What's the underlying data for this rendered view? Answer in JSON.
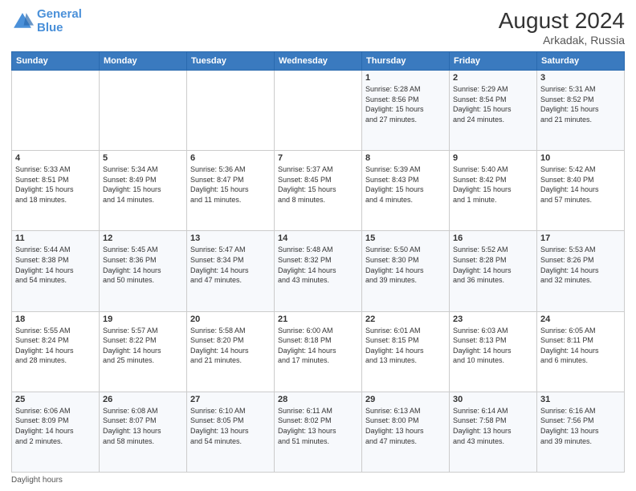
{
  "logo": {
    "line1": "General",
    "line2": "Blue"
  },
  "header": {
    "month_year": "August 2024",
    "location": "Arkadak, Russia"
  },
  "footer": {
    "note": "Daylight hours"
  },
  "days_of_week": [
    "Sunday",
    "Monday",
    "Tuesday",
    "Wednesday",
    "Thursday",
    "Friday",
    "Saturday"
  ],
  "weeks": [
    [
      {
        "day": "",
        "info": ""
      },
      {
        "day": "",
        "info": ""
      },
      {
        "day": "",
        "info": ""
      },
      {
        "day": "",
        "info": ""
      },
      {
        "day": "1",
        "info": "Sunrise: 5:28 AM\nSunset: 8:56 PM\nDaylight: 15 hours\nand 27 minutes."
      },
      {
        "day": "2",
        "info": "Sunrise: 5:29 AM\nSunset: 8:54 PM\nDaylight: 15 hours\nand 24 minutes."
      },
      {
        "day": "3",
        "info": "Sunrise: 5:31 AM\nSunset: 8:52 PM\nDaylight: 15 hours\nand 21 minutes."
      }
    ],
    [
      {
        "day": "4",
        "info": "Sunrise: 5:33 AM\nSunset: 8:51 PM\nDaylight: 15 hours\nand 18 minutes."
      },
      {
        "day": "5",
        "info": "Sunrise: 5:34 AM\nSunset: 8:49 PM\nDaylight: 15 hours\nand 14 minutes."
      },
      {
        "day": "6",
        "info": "Sunrise: 5:36 AM\nSunset: 8:47 PM\nDaylight: 15 hours\nand 11 minutes."
      },
      {
        "day": "7",
        "info": "Sunrise: 5:37 AM\nSunset: 8:45 PM\nDaylight: 15 hours\nand 8 minutes."
      },
      {
        "day": "8",
        "info": "Sunrise: 5:39 AM\nSunset: 8:43 PM\nDaylight: 15 hours\nand 4 minutes."
      },
      {
        "day": "9",
        "info": "Sunrise: 5:40 AM\nSunset: 8:42 PM\nDaylight: 15 hours\nand 1 minute."
      },
      {
        "day": "10",
        "info": "Sunrise: 5:42 AM\nSunset: 8:40 PM\nDaylight: 14 hours\nand 57 minutes."
      }
    ],
    [
      {
        "day": "11",
        "info": "Sunrise: 5:44 AM\nSunset: 8:38 PM\nDaylight: 14 hours\nand 54 minutes."
      },
      {
        "day": "12",
        "info": "Sunrise: 5:45 AM\nSunset: 8:36 PM\nDaylight: 14 hours\nand 50 minutes."
      },
      {
        "day": "13",
        "info": "Sunrise: 5:47 AM\nSunset: 8:34 PM\nDaylight: 14 hours\nand 47 minutes."
      },
      {
        "day": "14",
        "info": "Sunrise: 5:48 AM\nSunset: 8:32 PM\nDaylight: 14 hours\nand 43 minutes."
      },
      {
        "day": "15",
        "info": "Sunrise: 5:50 AM\nSunset: 8:30 PM\nDaylight: 14 hours\nand 39 minutes."
      },
      {
        "day": "16",
        "info": "Sunrise: 5:52 AM\nSunset: 8:28 PM\nDaylight: 14 hours\nand 36 minutes."
      },
      {
        "day": "17",
        "info": "Sunrise: 5:53 AM\nSunset: 8:26 PM\nDaylight: 14 hours\nand 32 minutes."
      }
    ],
    [
      {
        "day": "18",
        "info": "Sunrise: 5:55 AM\nSunset: 8:24 PM\nDaylight: 14 hours\nand 28 minutes."
      },
      {
        "day": "19",
        "info": "Sunrise: 5:57 AM\nSunset: 8:22 PM\nDaylight: 14 hours\nand 25 minutes."
      },
      {
        "day": "20",
        "info": "Sunrise: 5:58 AM\nSunset: 8:20 PM\nDaylight: 14 hours\nand 21 minutes."
      },
      {
        "day": "21",
        "info": "Sunrise: 6:00 AM\nSunset: 8:18 PM\nDaylight: 14 hours\nand 17 minutes."
      },
      {
        "day": "22",
        "info": "Sunrise: 6:01 AM\nSunset: 8:15 PM\nDaylight: 14 hours\nand 13 minutes."
      },
      {
        "day": "23",
        "info": "Sunrise: 6:03 AM\nSunset: 8:13 PM\nDaylight: 14 hours\nand 10 minutes."
      },
      {
        "day": "24",
        "info": "Sunrise: 6:05 AM\nSunset: 8:11 PM\nDaylight: 14 hours\nand 6 minutes."
      }
    ],
    [
      {
        "day": "25",
        "info": "Sunrise: 6:06 AM\nSunset: 8:09 PM\nDaylight: 14 hours\nand 2 minutes."
      },
      {
        "day": "26",
        "info": "Sunrise: 6:08 AM\nSunset: 8:07 PM\nDaylight: 13 hours\nand 58 minutes."
      },
      {
        "day": "27",
        "info": "Sunrise: 6:10 AM\nSunset: 8:05 PM\nDaylight: 13 hours\nand 54 minutes."
      },
      {
        "day": "28",
        "info": "Sunrise: 6:11 AM\nSunset: 8:02 PM\nDaylight: 13 hours\nand 51 minutes."
      },
      {
        "day": "29",
        "info": "Sunrise: 6:13 AM\nSunset: 8:00 PM\nDaylight: 13 hours\nand 47 minutes."
      },
      {
        "day": "30",
        "info": "Sunrise: 6:14 AM\nSunset: 7:58 PM\nDaylight: 13 hours\nand 43 minutes."
      },
      {
        "day": "31",
        "info": "Sunrise: 6:16 AM\nSunset: 7:56 PM\nDaylight: 13 hours\nand 39 minutes."
      }
    ]
  ]
}
